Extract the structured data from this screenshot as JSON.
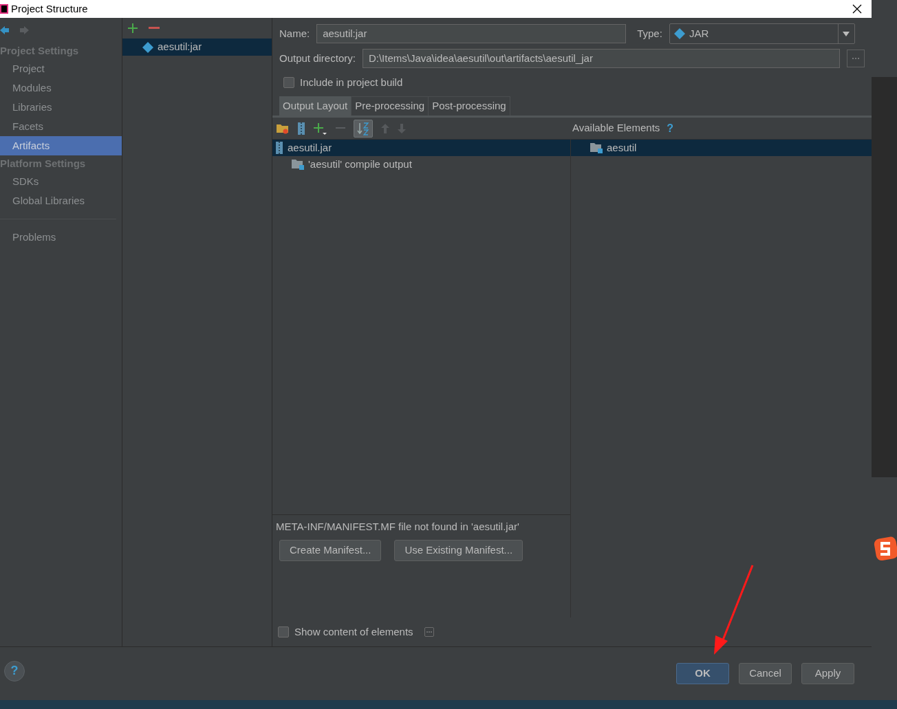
{
  "window": {
    "title": "Project Structure"
  },
  "sidebar": {
    "items": [
      {
        "kind": "header",
        "label": "Project Settings"
      },
      {
        "kind": "item",
        "label": "Project",
        "selected": false
      },
      {
        "kind": "item",
        "label": "Modules",
        "selected": false
      },
      {
        "kind": "item",
        "label": "Libraries",
        "selected": false
      },
      {
        "kind": "item",
        "label": "Facets",
        "selected": false
      },
      {
        "kind": "item",
        "label": "Artifacts",
        "selected": true
      },
      {
        "kind": "header",
        "label": "Platform Settings"
      },
      {
        "kind": "item",
        "label": "SDKs",
        "selected": false
      },
      {
        "kind": "item",
        "label": "Global Libraries",
        "selected": false
      },
      {
        "kind": "separator"
      },
      {
        "kind": "item",
        "label": "Problems",
        "selected": false
      }
    ]
  },
  "artifacts": [
    {
      "label": "aesutil:jar",
      "selected": true
    }
  ],
  "form": {
    "name_label": "Name:",
    "name_value": "aesutil:jar",
    "type_label": "Type:",
    "type_value": "JAR",
    "output_label": "Output directory:",
    "output_value": "D:\\Items\\Java\\idea\\aesutil\\out\\artifacts\\aesutil_jar",
    "include": {
      "label": "Include in project build",
      "checked": false
    }
  },
  "tabs": [
    {
      "label": "Output Layout",
      "selected": true
    },
    {
      "label": "Pre-processing",
      "selected": false
    },
    {
      "label": "Post-processing",
      "selected": false
    }
  ],
  "layout_tree": [
    {
      "kind": "jar",
      "label": "aesutil.jar",
      "selected": true,
      "children": [
        {
          "kind": "folder",
          "label": "'aesutil' compile output",
          "selected": false
        }
      ]
    }
  ],
  "available": {
    "title": "Available Elements",
    "help": "?",
    "items": [
      {
        "kind": "folder",
        "label": "aesutil",
        "selected": true
      }
    ]
  },
  "manifest": {
    "message": "META-INF/MANIFEST.MF file not found in 'aesutil.jar'",
    "buttons": [
      "Create Manifest...",
      "Use Existing Manifest..."
    ]
  },
  "show_content": {
    "label": "Show content of elements",
    "checked": false
  },
  "footer": {
    "help": "?",
    "buttons": [
      {
        "label": "OK",
        "kind": "primary"
      },
      {
        "label": "Cancel",
        "kind": "normal"
      },
      {
        "label": "Apply",
        "kind": "normal"
      }
    ]
  }
}
